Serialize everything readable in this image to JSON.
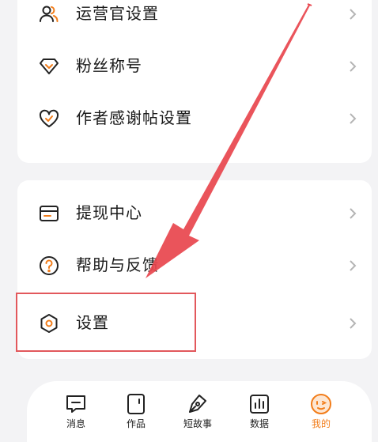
{
  "menu_group_1": {
    "items": [
      {
        "label": "运营官设置",
        "icon": "operator-users-icon"
      },
      {
        "label": "粉丝称号",
        "icon": "fan-badge-icon"
      },
      {
        "label": "作者感谢帖设置",
        "icon": "thanks-heart-icon"
      }
    ]
  },
  "menu_group_2": {
    "items": [
      {
        "label": "提现中心",
        "icon": "wallet-icon"
      },
      {
        "label": "帮助与反馈",
        "icon": "help-question-icon"
      },
      {
        "label": "设置",
        "icon": "settings-hexagon-icon"
      }
    ]
  },
  "tabbar": {
    "tabs": [
      {
        "label": "消息",
        "icon": "message-icon"
      },
      {
        "label": "作品",
        "icon": "works-icon"
      },
      {
        "label": "短故事",
        "icon": "pen-icon"
      },
      {
        "label": "数据",
        "icon": "chart-icon"
      },
      {
        "label": "我的",
        "icon": "profile-face-icon"
      }
    ],
    "active_index": 4
  },
  "colors": {
    "accent": "#f27d1a",
    "annotation": "#e2585c",
    "text": "#1a1a1a",
    "background": "#f3f3f5"
  }
}
